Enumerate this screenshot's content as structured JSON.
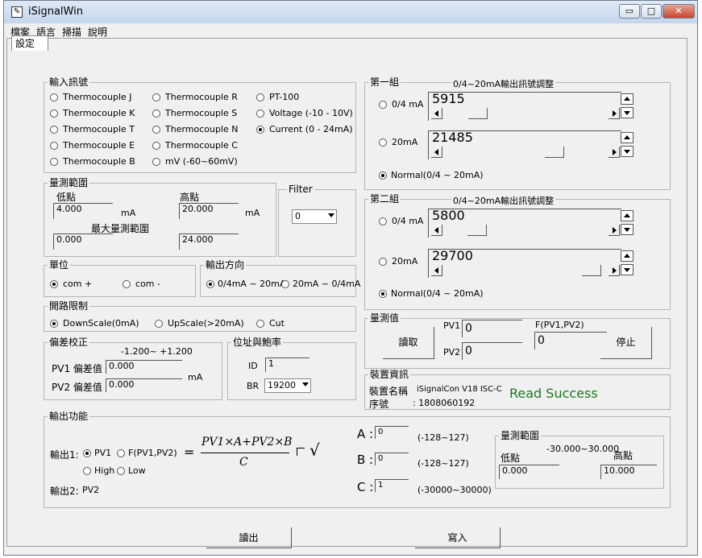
{
  "window": {
    "title": "iSignalWin",
    "icon": "pen-icon",
    "minimize": "▭",
    "maximize": "□",
    "close": "✕"
  },
  "menu": [
    "檔案",
    "語言",
    "掃描",
    "說明"
  ],
  "tab": "設定",
  "input_signal": {
    "legend": "輸入訊號",
    "options": [
      "Thermocouple J",
      "Thermocouple K",
      "Thermocouple T",
      "Thermocouple E",
      "Thermocouple B",
      "Thermocouple R",
      "Thermocouple S",
      "Thermocouple N",
      "Thermocouple C",
      "mV (-60~60mV)",
      "PT-100",
      "Voltage (-10 - 10V)",
      "Current (0 - 24mA)"
    ],
    "selected": "Current (0 - 24mA)"
  },
  "range": {
    "legend": "量測範圍",
    "low_label": "低點",
    "high_label": "高點",
    "low_value": "4.000",
    "high_value": "20.000",
    "unit1": "mA",
    "unit2": "mA",
    "max_label": "最大量測範圍",
    "max_low": "0.000",
    "max_high": "24.000"
  },
  "filter": {
    "legend": "Filter",
    "value": "0"
  },
  "unit": {
    "legend": "單位",
    "options": [
      "com +",
      "com -"
    ],
    "selected": "com +"
  },
  "output_direction": {
    "legend": "輸出方向",
    "options": [
      "0/4mA ~ 20mA",
      "20mA ~ 0/4mA"
    ],
    "selected": "0/4mA ~ 20mA"
  },
  "open_circuit": {
    "legend": "開路限制",
    "options": [
      "DownScale(0mA)",
      "UpScale(>20mA)",
      "Cut"
    ],
    "selected": "DownScale(0mA)"
  },
  "offset": {
    "legend": "偏差校正",
    "range": "-1.200~ +1.200",
    "pv1_label": "PV1 偏差值",
    "pv1_value": "0.000",
    "pv2_label": "PV2 偏差值",
    "pv2_value": "0.000",
    "unit": "mA"
  },
  "address": {
    "legend": "位址與鮑率",
    "id_label": "ID",
    "id_value": "1",
    "br_label": "BR",
    "br_value": "19200"
  },
  "group1": {
    "legend": "第一組",
    "subtitle": "0/4~20mA輸出訊號調整",
    "opt1": "0/4 mA",
    "val1": "5915",
    "opt2": "20mA",
    "val2": "21485",
    "normal": "Normal(0/4 ~ 20mA)"
  },
  "group2": {
    "legend": "第二組",
    "subtitle": "0/4~20mA輸出訊號調整",
    "opt1": "0/4 mA",
    "val1": "5800",
    "opt2": "20mA",
    "val2": "29700",
    "normal": "Normal(0/4 ~ 20mA)"
  },
  "measure": {
    "legend": "量測值",
    "read_button": "讀取",
    "pv1_label": "PV1",
    "pv1_value": "0",
    "pv2_label": "PV2",
    "pv2_value": "0",
    "f_label": "F(PV1,PV2)",
    "f_value": "0",
    "stop_button": "停止"
  },
  "device": {
    "legend": "裝置資訊",
    "name_label": "裝置名稱",
    "name_value": "iSignalCon  V18  ISC-C",
    "serial_label": "序號",
    "serial_value": ": 1808060192",
    "status": "Read Success",
    "status_color": "#1a7a1a"
  },
  "output_func": {
    "legend": "輸出功能",
    "out1_label": "輸出1:",
    "out1_options": [
      "PV1",
      "F(PV1,PV2)"
    ],
    "out1_selected": "PV1",
    "formula_lhs": "=",
    "formula_num": "PV1×A+PV2×B",
    "formula_den": "C",
    "sqrt": "√",
    "high": "High",
    "low": "Low",
    "out2_label": "輸出2:",
    "out2_value": "PV2",
    "a_label": "A :",
    "a_value": "0",
    "a_range": "(-128~127)",
    "b_label": "B :",
    "b_value": "0",
    "b_range": "(-128~127)",
    "c_label": "C :",
    "c_value": "1",
    "c_range": "(-30000~30000)"
  },
  "out_range": {
    "legend": "量測範圍",
    "range": "-30.000~30.000",
    "low_label": "低點",
    "high_label": "高點",
    "low_value": "0.000",
    "high_value": "10.000"
  },
  "buttons": {
    "read_out": "讀出",
    "write": "寫入"
  }
}
